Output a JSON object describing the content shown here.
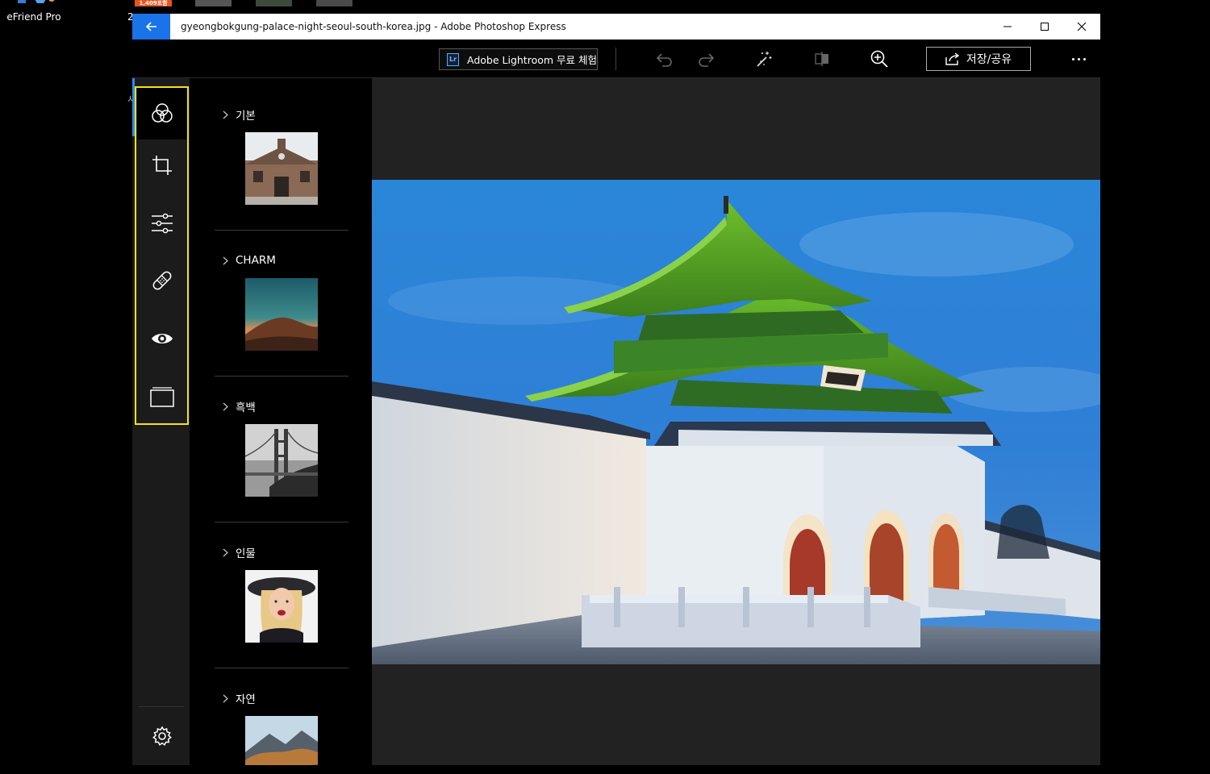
{
  "desktop": {
    "icon_label": "eFriend Pro",
    "badge_text": "1,409포함",
    "edge_char": "2",
    "edge_char_2": "시"
  },
  "window": {
    "title": "gyeongbokgung-palace-night-seoul-south-korea.jpg - Adobe Photoshop Express",
    "controls": {
      "minimize": "minimize",
      "maximize": "maximize",
      "close": "close"
    }
  },
  "toolbar": {
    "lightroom_badge": "Lr",
    "lightroom_label": "Adobe Lightroom 무료 체험",
    "share_label": "저장/공유",
    "icons": [
      "undo-icon",
      "redo-icon",
      "auto-fix-icon",
      "compare-icon",
      "zoom-in-icon",
      "more-icon"
    ]
  },
  "tool_rail": {
    "items": [
      "looks",
      "crop",
      "adjustments",
      "heal",
      "red-eye",
      "borders"
    ],
    "active": "looks",
    "settings": "settings"
  },
  "looks": {
    "categories": [
      {
        "name": "기본"
      },
      {
        "name": "CHARM"
      },
      {
        "name": "흑백"
      },
      {
        "name": "인물"
      },
      {
        "name": "자연"
      }
    ]
  },
  "colors": {
    "accent": "#1a73e8",
    "highlight": "#f5e11b",
    "panel_bg": "#000000",
    "canvas_bg": "#222222"
  }
}
